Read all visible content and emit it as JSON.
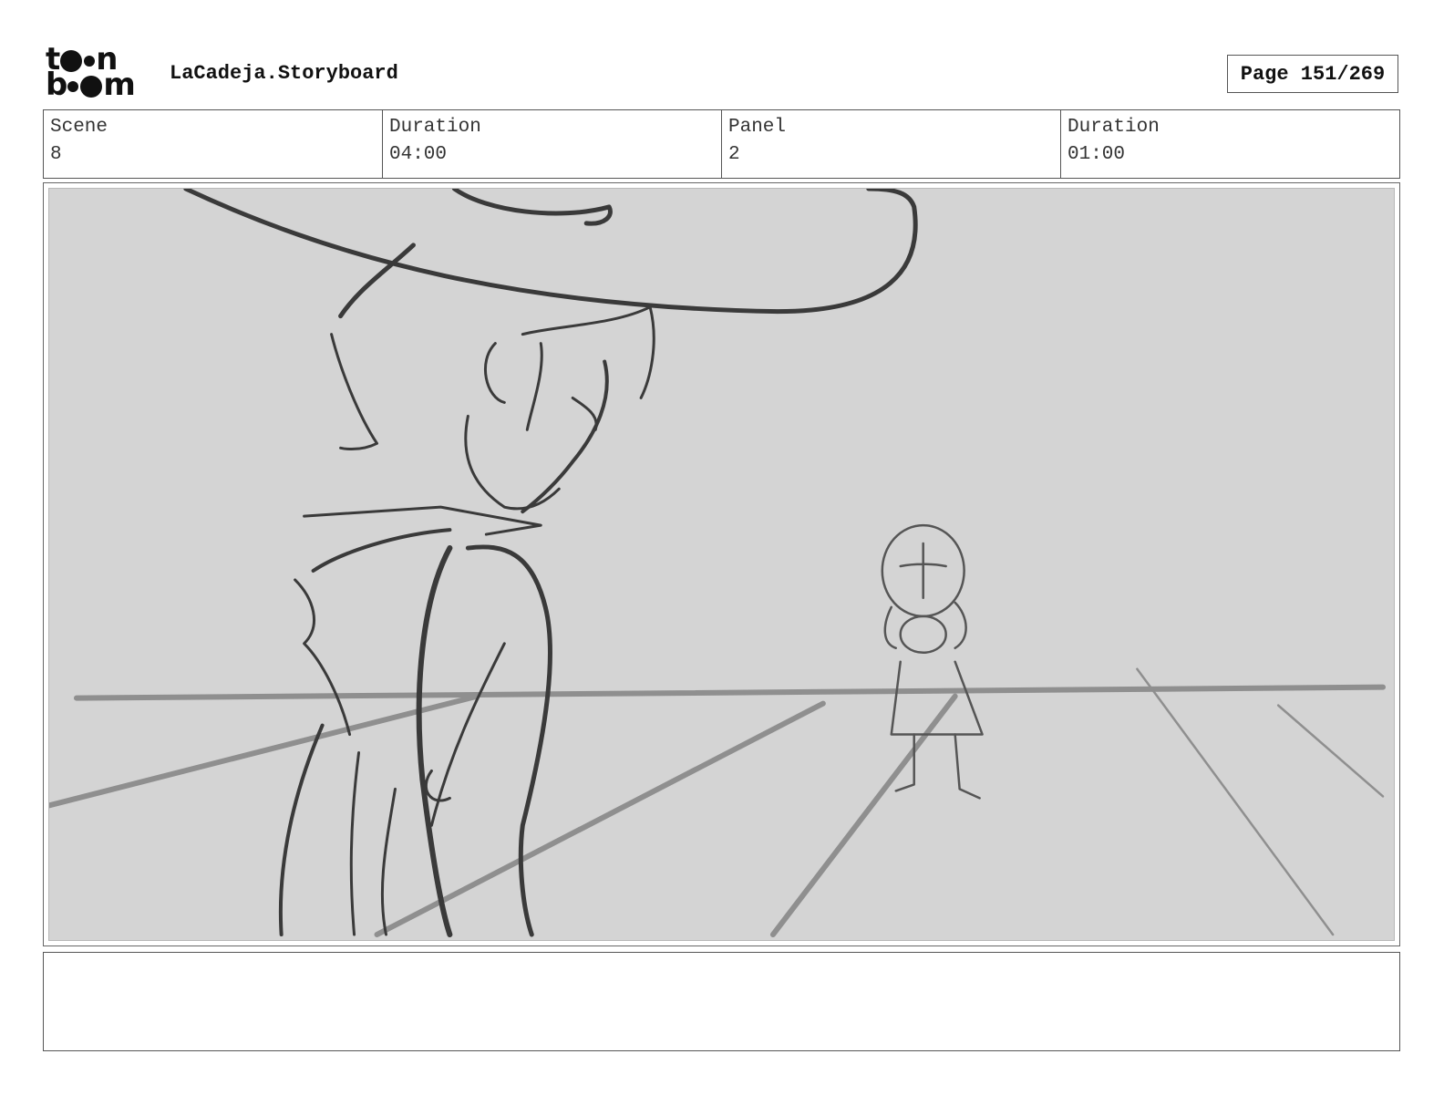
{
  "header": {
    "logo": {
      "top_letters": [
        "t",
        "n"
      ],
      "bottom_letters": [
        "b",
        "m"
      ],
      "brand": "toon boom"
    },
    "title": "LaCadeja.Storyboard",
    "page_label": "Page 151/269"
  },
  "info": {
    "scene_label": "Scene",
    "scene_value": "8",
    "scene_duration_label": "Duration",
    "scene_duration_value": "04:00",
    "panel_label": "Panel",
    "panel_value": "2",
    "panel_duration_label": "Duration",
    "panel_duration_value": "01:00"
  },
  "panel": {
    "background_color": "#d4d4d4",
    "line_color": "#3a3a3a",
    "perspective_line_color": "#8f8f8f"
  },
  "notes": {
    "text": ""
  }
}
